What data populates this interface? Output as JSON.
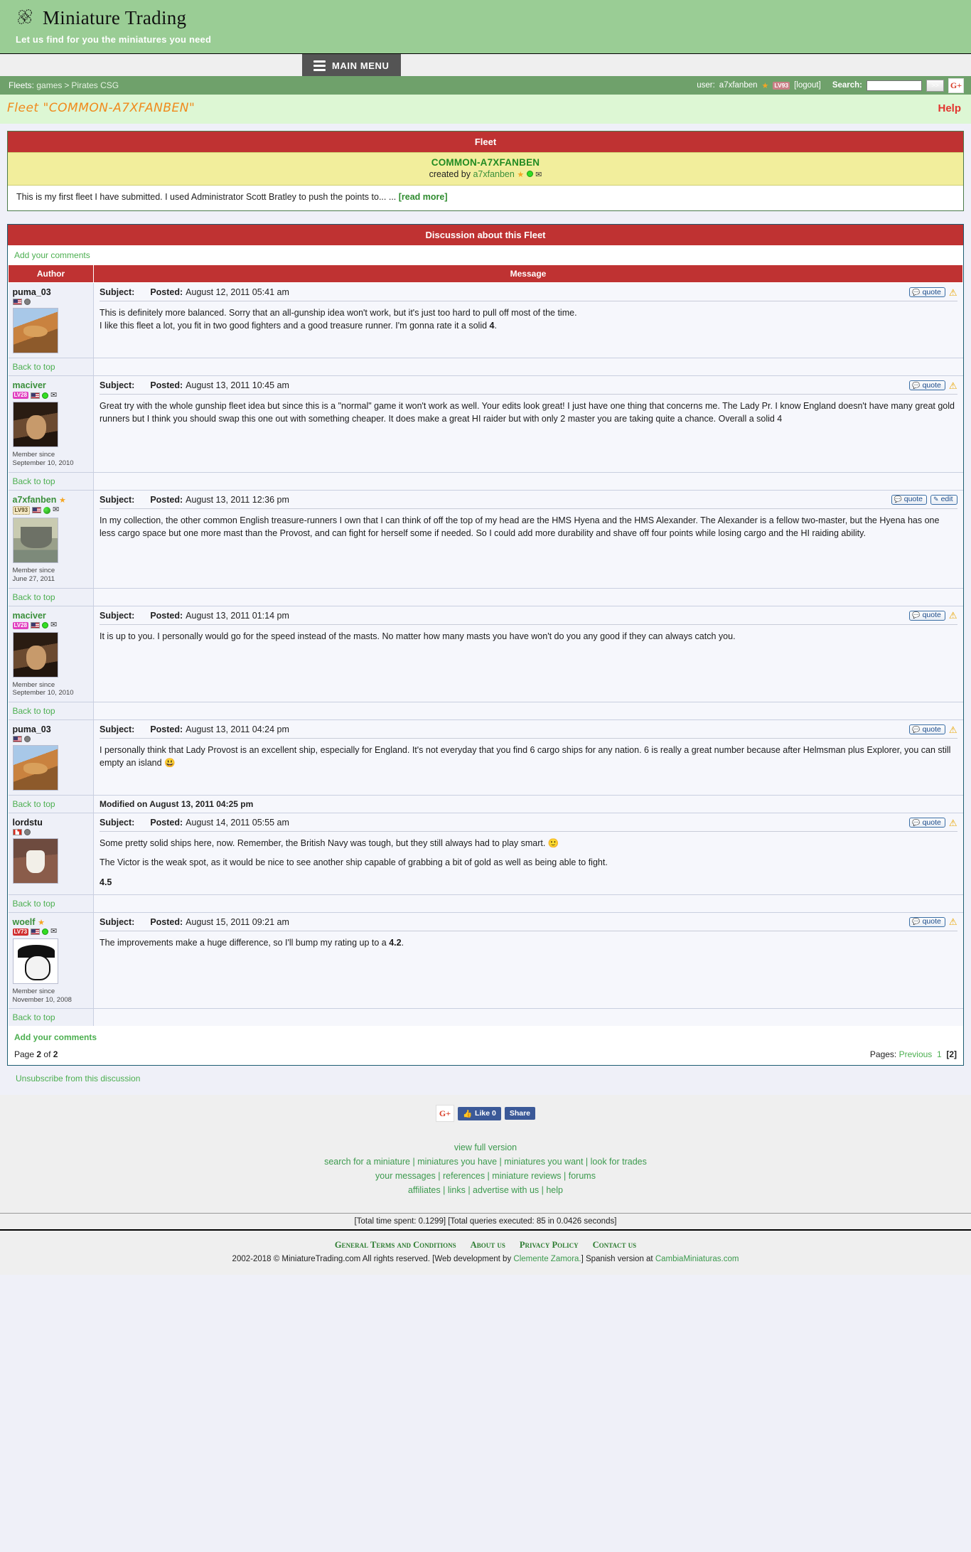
{
  "site": {
    "title": "Miniature Trading",
    "tagline": "Let us find for you the miniatures you need",
    "logo_icon": "flower-logo-icon"
  },
  "menu": {
    "main_menu_label": "MAIN MENU"
  },
  "nav": {
    "crumb_label": "Fleets:",
    "crumb_games": "games",
    "crumb_sep": ">",
    "crumb_game": "Pirates CSG",
    "user_label": "user:",
    "user_name": "a7xfanben",
    "user_level": "LV93",
    "logout": "[logout]",
    "search_label": "Search:",
    "search_value": "",
    "search_placeholder": "",
    "go_label": ">>",
    "gplus_label": "G+"
  },
  "page": {
    "fleet_title": "Fleet \"COMMON-A7XFANBEN\"",
    "help": "Help"
  },
  "fleet_panel": {
    "head": "Fleet",
    "name": "COMMON-A7XFANBEN",
    "created_by_label": "created by",
    "creator": "a7xfanben",
    "description": "This is my first fleet I have submitted. I used Administrator Scott Bratley to push the points to... ...",
    "read_more": "[read more]"
  },
  "discussion": {
    "head": "Discussion about this Fleet",
    "add_comments_top": "Add your comments",
    "add_comments_bottom": "Add your comments",
    "col_author": "Author",
    "col_message": "Message",
    "subject_label": "Subject:",
    "posted_label": "Posted:",
    "back_to_top": "Back to top",
    "quote_label": "quote",
    "edit_label": "edit",
    "page_info_prefix": "Page",
    "page_current": "2",
    "page_of": "of",
    "page_total": "2",
    "pages_label": "Pages:",
    "pages_previous": "Previous",
    "pages_1": "1",
    "pages_2": "[2]",
    "unsubscribe": "Unsubscribe from this discussion",
    "member_since_label": "Member since",
    "posts": [
      {
        "author": "puma_03",
        "author_color": "dark",
        "level": null,
        "flag": "us",
        "status": "grey",
        "has_envelope": false,
        "avatar": "av-puma",
        "member_since": null,
        "posted": "August 12, 2011 05:41 am",
        "can_edit": false,
        "paragraphs": [
          "This is definitely more balanced. Sorry that an all-gunship idea won't work, but it's just too hard to pull off most of the time.<br>I like this fleet a lot, you fit in two good fighters and a good treasure runner. I'm gonna rate it a solid <b>4</b>."
        ],
        "modified": null
      },
      {
        "author": "maciver",
        "author_color": "green",
        "level": "LV28",
        "level_style": "magenta",
        "flag": "us",
        "status": "green",
        "has_envelope": true,
        "avatar": "av-maciver",
        "member_since": "September 10, 2010",
        "posted": "August 13, 2011 10:45 am",
        "can_edit": false,
        "paragraphs": [
          "Great try with the whole gunship fleet idea but since this is a \"normal\" game it won't work as well. Your edits look great! I just have one thing that concerns me. The Lady Pr. I know England doesn't have many great gold runners but I think you should swap this one out with something cheaper. It does make a great HI raider but with only 2 master you are taking quite a chance. Overall a solid 4"
        ],
        "modified": null
      },
      {
        "author": "a7xfanben",
        "author_color": "green",
        "has_star": true,
        "level": "LV93",
        "level_style": "cream",
        "flag": "us",
        "status": "globe",
        "has_envelope": true,
        "avatar": "av-ship",
        "member_since": "June 27, 2011",
        "posted": "August 13, 2011 12:36 pm",
        "can_edit": true,
        "paragraphs": [
          "In my collection, the other common English treasure-runners I own that I can think of off the top of my head are the HMS Hyena and the HMS Alexander. The Alexander is a fellow two-master, but the Hyena has one less cargo space but one more mast than the Provost, and can fight for herself some if needed. So I could add more durability and shave off four points while losing cargo and the HI raiding ability."
        ],
        "modified": null
      },
      {
        "author": "maciver",
        "author_color": "green",
        "level": "LV28",
        "level_style": "magenta",
        "flag": "us",
        "status": "green",
        "has_envelope": true,
        "avatar": "av-maciver",
        "member_since": "September 10, 2010",
        "posted": "August 13, 2011 01:14 pm",
        "can_edit": false,
        "paragraphs": [
          "It is up to you. I personally would go for the speed instead of the masts. No matter how many masts you have won't do you any good if they can always catch you."
        ],
        "modified": null
      },
      {
        "author": "puma_03",
        "author_color": "dark",
        "level": null,
        "flag": "us",
        "status": "grey",
        "has_envelope": false,
        "avatar": "av-puma",
        "member_since": null,
        "posted": "August 13, 2011 04:24 pm",
        "can_edit": false,
        "paragraphs": [
          "I personally think that Lady Provost is an excellent ship, especially for England. It's not everyday that you find 6 cargo ships for any nation. 6 is really a great number because after Helmsman plus Explorer, you can still empty an island 😃"
        ],
        "modified": "Modified on August 13, 2011 04:25 pm"
      },
      {
        "author": "lordstu",
        "author_color": "dark",
        "level": null,
        "flag": "ca",
        "status": "grey",
        "has_envelope": false,
        "avatar": "av-cup",
        "member_since": null,
        "posted": "August 14, 2011 05:55 am",
        "can_edit": false,
        "paragraphs": [
          "Some pretty solid ships here, now. Remember, the British Navy was tough, but they still always had to play smart. 🙂",
          "The Victor is the weak spot, as it would be nice to see another ship capable of grabbing a bit of gold as well as being able to fight.",
          "<b>4.5</b>"
        ],
        "modified": null
      },
      {
        "author": "woelf",
        "author_color": "green",
        "has_star": true,
        "level": "LV73",
        "level_style": "red",
        "flag": "us",
        "status": "green",
        "has_envelope": true,
        "avatar": "av-skull",
        "member_since": "November 10, 2008",
        "posted": "August 15, 2011 09:21 am",
        "can_edit": false,
        "paragraphs": [
          "The improvements make a huge difference, so I'll bump my rating up to a <b>4.2</b>."
        ],
        "modified": null
      }
    ]
  },
  "footer": {
    "gplus": "G+",
    "fb_like": "Like 0",
    "fb_share": "Share",
    "view_full": "view full version",
    "links_row2": [
      "search for a miniature",
      "miniatures you have",
      "miniatures you want",
      "look for trades"
    ],
    "links_row3": [
      "your messages",
      "references",
      "miniature reviews",
      "forums"
    ],
    "links_row4": [
      "affiliates",
      "links",
      "advertise with us",
      "help"
    ],
    "stats": "[Total time spent: 0.1299] [Total queries executed: 85 in 0.0426 seconds]",
    "legal_links": [
      "General Terms and Conditions",
      "About us",
      "Privacy Policy",
      "Contact us"
    ],
    "copy_pre": "2002-2018 © MiniatureTrading.com All rights reserved. [Web development by ",
    "copy_dev": "Clemente Zamora.",
    "copy_mid": "] Spanish version at ",
    "copy_es": "CambiaMiniaturas.com"
  }
}
